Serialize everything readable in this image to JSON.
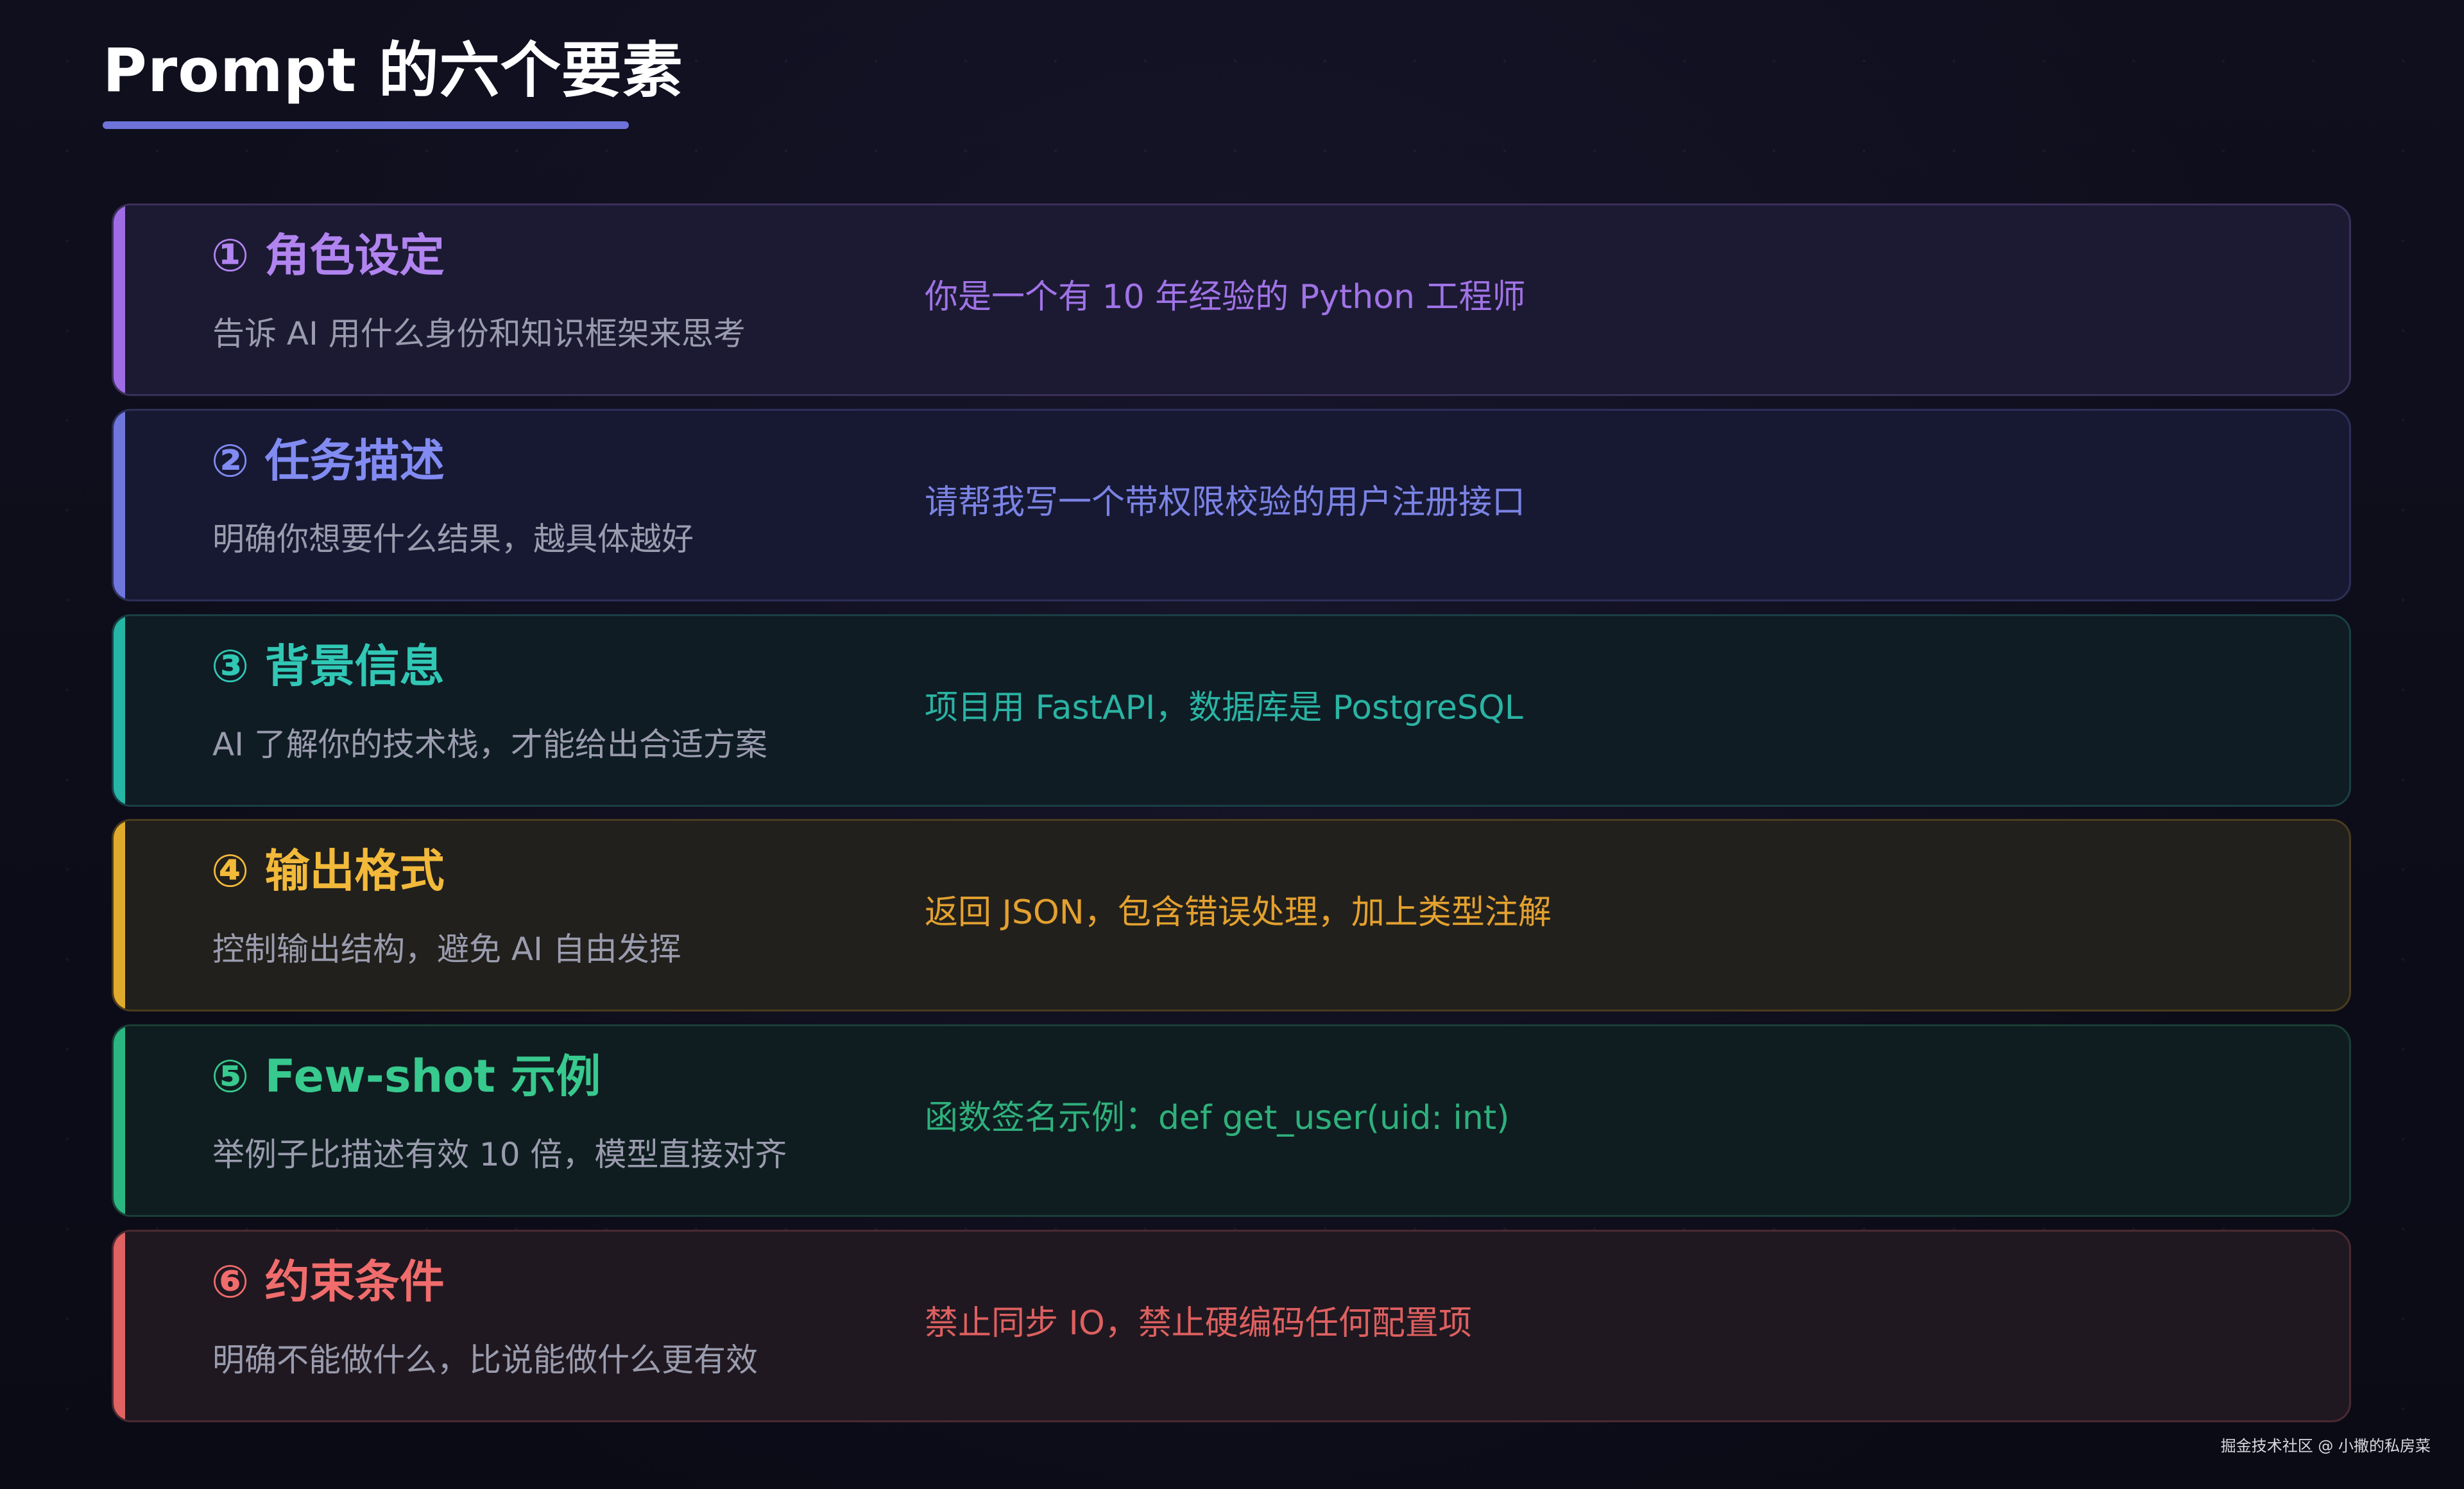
{
  "header": {
    "title": "Prompt 的六个要素",
    "underline_color": "#6d73d8"
  },
  "elements": [
    {
      "title": "① 角色设定",
      "description": "告诉 AI 用什么身份和知识框架来思考",
      "example": "你是一个有 10 年经验的 Python 工程师",
      "accent_color": "#a06ce6",
      "title_color": "#b184f0",
      "example_color": "#a073e6",
      "background": "#1c1a33",
      "border": "#3a3059"
    },
    {
      "title": "② 任务描述",
      "description": "明确你想要什么结果，越具体越好",
      "example": "请帮我写一个带权限校验的用户注册接口",
      "accent_color": "#6f76dc",
      "title_color": "#818bf2",
      "example_color": "#7b83e4",
      "background": "#171933",
      "border": "#2d2f58"
    },
    {
      "title": "③ 背景信息",
      "description": "AI 了解你的技术栈，才能给出合适方案",
      "example": "项目用 FastAPI，数据库是 PostgreSQL",
      "accent_color": "#25b6a6",
      "title_color": "#31c7b5",
      "example_color": "#2ab3a3",
      "background": "#0f1c24",
      "border": "#1a3f45"
    },
    {
      "title": "④ 输出格式",
      "description": "控制输出结构，避免 AI 自由发挥",
      "example": "返回 JSON，包含错误处理，加上类型注解",
      "accent_color": "#e0ab2c",
      "title_color": "#f2b93a",
      "example_color": "#e3a12f",
      "background": "#22201c",
      "border": "#4a3c1e"
    },
    {
      "title": "⑤ Few-shot 示例",
      "description": "举例子比描述有效 10 倍，模型直接对齐",
      "example": "函数签名示例：def get_user(uid: int)",
      "accent_color": "#2bb781",
      "title_color": "#38c98e",
      "example_color": "#2fb07c",
      "background": "#0f1d20",
      "border": "#1b3e36"
    },
    {
      "title": "⑥ 约束条件",
      "description": "明确不能做什么，比说能做什么更有效",
      "example": "禁止同步 IO，禁止硬编码任何配置项",
      "accent_color": "#e06262",
      "title_color": "#f16c6c",
      "example_color": "#de6060",
      "background": "#201820",
      "border": "#4a2a32"
    }
  ],
  "footer": {
    "watermark": "掘金技术社区 @ 小撒的私房菜"
  }
}
